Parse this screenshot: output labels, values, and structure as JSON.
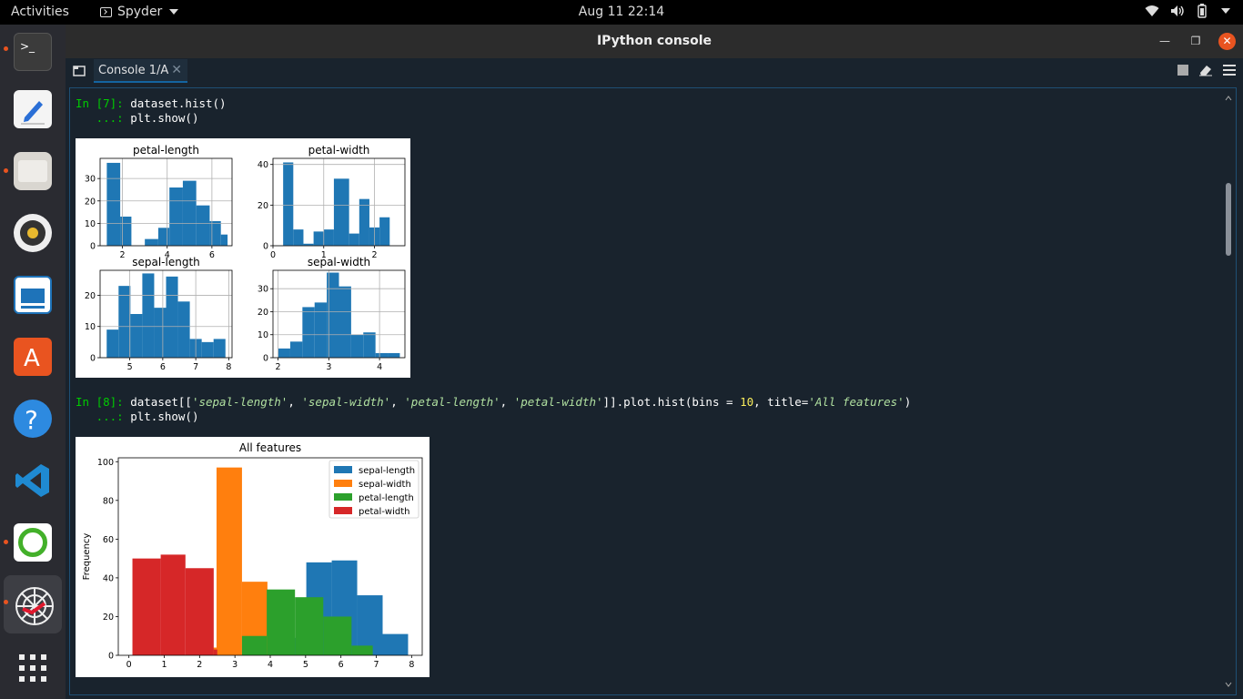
{
  "topbar": {
    "activities": "Activities",
    "app_name": "Spyder",
    "clock": "Aug 11  22:14"
  },
  "dock": {
    "items": [
      "terminal",
      "text-editor",
      "files",
      "rhythmbox",
      "libreoffice-impress",
      "app-center",
      "help",
      "vscode",
      "anaconda",
      "spyder"
    ]
  },
  "window": {
    "title": "IPython console",
    "tab_label": "Console 1/A"
  },
  "console": {
    "cell7": {
      "prompt": "In [7]:",
      "line1": "dataset.hist()",
      "cont": "   ...:",
      "line2": "plt.show()"
    },
    "cell8": {
      "prompt": "In [8]:",
      "line1_a": "dataset[[",
      "s1": "'sepal-length'",
      "s2": "'sepal-width'",
      "s3": "'petal-length'",
      "s4": "'petal-width'",
      "line1_b": "]].plot.hist(bins = ",
      "bins": "10",
      "line1_c": ", title=",
      "title_str": "'All features'",
      "line1_d": ")",
      "cont": "   ...:",
      "line2": "plt.show()"
    }
  },
  "chart_data": [
    {
      "type": "bar",
      "title": "petal-length",
      "x": [
        1.3,
        1.9,
        2.4,
        3.0,
        3.6,
        4.1,
        4.7,
        5.3,
        5.9,
        6.4
      ],
      "values": [
        37,
        13,
        0,
        3,
        8,
        26,
        29,
        18,
        11,
        5
      ],
      "xticks": [
        2,
        4,
        6
      ],
      "yticks": [
        0,
        10,
        20,
        30
      ],
      "xlim": [
        1.0,
        6.9
      ],
      "ylim": [
        0,
        39
      ],
      "grid": true,
      "color": "#1f77b4"
    },
    {
      "type": "bar",
      "title": "petal-width",
      "x": [
        0.2,
        0.4,
        0.6,
        0.8,
        1.0,
        1.2,
        1.5,
        1.7,
        1.9,
        2.1,
        2.3
      ],
      "values": [
        41,
        8,
        1,
        7,
        8,
        33,
        6,
        23,
        9,
        14
      ],
      "xticks": [
        0,
        1,
        2
      ],
      "yticks": [
        0,
        20,
        40
      ],
      "xlim": [
        0.0,
        2.6
      ],
      "ylim": [
        0,
        43
      ],
      "grid": true,
      "color": "#1f77b4"
    },
    {
      "type": "bar",
      "title": "sepal-length",
      "x": [
        4.3,
        4.66,
        5.02,
        5.38,
        5.74,
        6.1,
        6.46,
        6.82,
        7.18,
        7.54,
        7.9
      ],
      "values": [
        9,
        23,
        14,
        27,
        16,
        26,
        18,
        6,
        5,
        6
      ],
      "xticks": [
        5,
        6,
        7,
        8
      ],
      "yticks": [
        0,
        10,
        20
      ],
      "xlim": [
        4.1,
        8.1
      ],
      "ylim": [
        0,
        28
      ],
      "grid": true,
      "color": "#1f77b4"
    },
    {
      "type": "bar",
      "title": "sepal-width",
      "x": [
        2.0,
        2.24,
        2.48,
        2.72,
        2.96,
        3.2,
        3.44,
        3.68,
        3.92,
        4.16,
        4.4
      ],
      "values": [
        4,
        7,
        22,
        24,
        37,
        31,
        10,
        11,
        2,
        2
      ],
      "xticks": [
        2,
        3,
        4
      ],
      "yticks": [
        0,
        10,
        20,
        30
      ],
      "xlim": [
        1.9,
        4.5
      ],
      "ylim": [
        0,
        38
      ],
      "grid": true,
      "color": "#1f77b4"
    },
    {
      "type": "bar",
      "title": "All features",
      "ylabel": "Frequency",
      "xticks": [
        0,
        1,
        2,
        3,
        4,
        5,
        6,
        7,
        8
      ],
      "yticks": [
        0,
        20,
        40,
        60,
        80,
        100
      ],
      "xlim": [
        -0.3,
        8.3
      ],
      "ylim": [
        0,
        102
      ],
      "grid": false,
      "legend_position": "top-right",
      "series": [
        {
          "name": "sepal-length",
          "color": "#1f77b4",
          "edges": [
            4.3,
            5.02,
            5.74,
            6.46,
            7.18,
            7.9
          ],
          "values": [
            9,
            48,
            49,
            31,
            11
          ]
        },
        {
          "name": "sepal-width",
          "color": "#ff7f0e",
          "edges": [
            2.0,
            2.4,
            2.48,
            3.2,
            3.92,
            4.4
          ],
          "values": [
            4,
            4,
            97,
            38,
            10
          ]
        },
        {
          "name": "petal-length",
          "color": "#2ca02c",
          "edges": [
            3.2,
            3.9,
            4.7,
            5.5,
            6.3,
            6.9
          ],
          "values": [
            10,
            34,
            30,
            20,
            5
          ]
        },
        {
          "name": "petal-width",
          "color": "#d62728",
          "edges": [
            0.1,
            0.9,
            1.6,
            2.4,
            2.5
          ],
          "values": [
            50,
            52,
            45,
            3
          ]
        }
      ]
    }
  ]
}
